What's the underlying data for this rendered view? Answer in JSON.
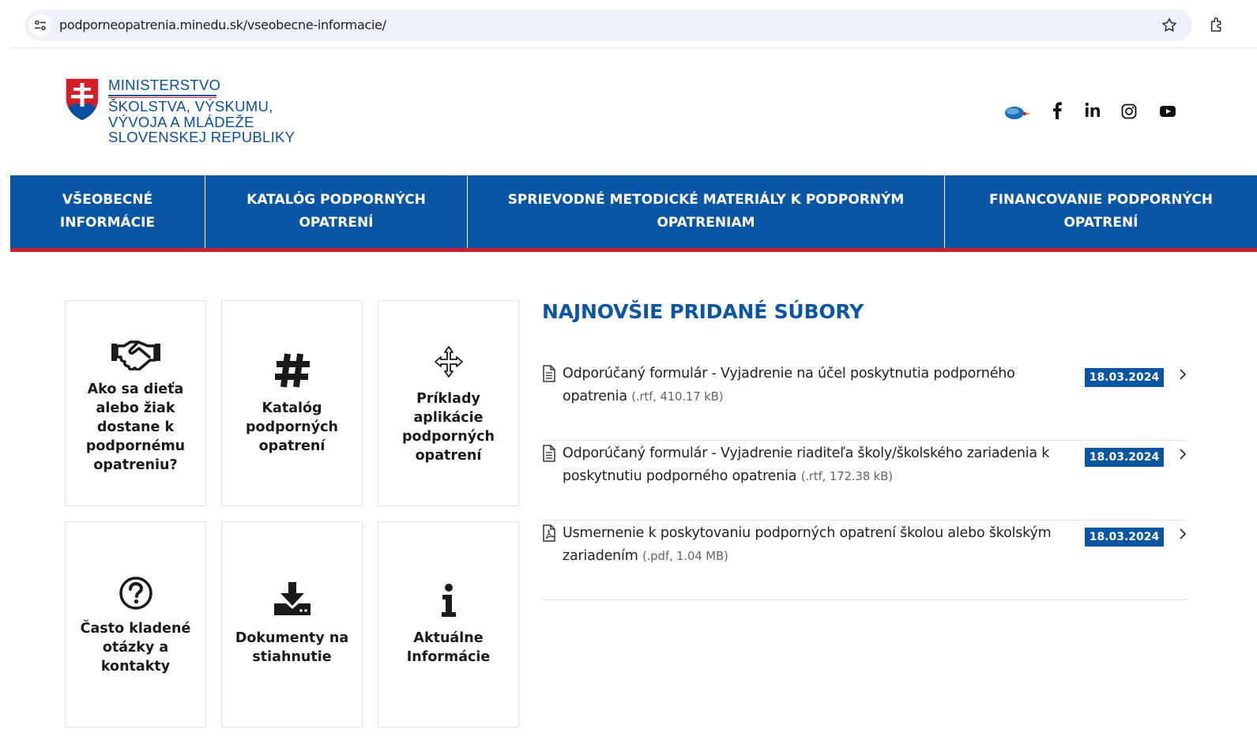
{
  "browser": {
    "url": "podporneopatrenia.minedu.sk/vseobecne-informacie/",
    "icons": [
      "site-info-icon",
      "star-icon",
      "extensions-icon"
    ]
  },
  "header": {
    "logo_line1": "MINISTERSTVO",
    "logo_line2": "ŠKOLSTVA, VÝSKUMU,",
    "logo_line3": "VÝVOJA A MLÁDEŽE",
    "logo_line4": "SLOVENSKEJ REPUBLIKY",
    "social": [
      "edu-tv-icon",
      "facebook-icon",
      "linkedin-icon",
      "instagram-icon",
      "youtube-icon"
    ]
  },
  "nav": {
    "items": [
      {
        "line1": "VŠEOBECNÉ",
        "line2": "INFORMÁCIE"
      },
      {
        "line1": "KATALÓG PODPORNÝCH",
        "line2": "OPATRENÍ"
      },
      {
        "line1": "SPRIEVODNÉ METODICKÉ MATERIÁLY K PODPORNÝM",
        "line2": "OPATRENIAM"
      },
      {
        "line1": "FINANCOVANIE PODPORNÝCH",
        "line2": "OPATRENÍ"
      }
    ]
  },
  "tiles": [
    {
      "label": "Ako sa dieťa alebo žiak dostane k podpornému opatreniu?",
      "icon": "handshake-icon"
    },
    {
      "label": "Katalóg podporných opatrení",
      "icon": "hashtag-icon"
    },
    {
      "label": "Príklady aplikácie podporných opatrení",
      "icon": "arrows-move-icon"
    },
    {
      "label": "Často kladené otázky a kontakty",
      "icon": "question-circle-icon"
    },
    {
      "label": "Dokumenty na stiahnutie",
      "icon": "download-icon"
    },
    {
      "label": "Aktuálne Informácie",
      "icon": "info-icon"
    }
  ],
  "files": {
    "title": "NAJNOVŠIE PRIDANÉ SÚBORY",
    "items": [
      {
        "text": "Odporúčaný formulár - Vyjadrenie na účel poskytnutia podporného opatrenia",
        "meta": "(.rtf, 410.17 kB)",
        "date": "18.03.2024",
        "icon": "document-icon"
      },
      {
        "text": "Odporúčaný formulár - Vyjadrenie riaditeľa školy/školského zariadenia k poskytnutiu podporného opatrenia",
        "meta": "(.rtf, 172.38 kB)",
        "date": "18.03.2024",
        "icon": "document-icon"
      },
      {
        "text": "Usmernenie k poskytovaniu podporných opatrení školou alebo školským zariadením",
        "meta": "(.pdf, 1.04 MB)",
        "date": "18.03.2024",
        "icon": "pdf-icon"
      }
    ]
  },
  "colors": {
    "primary": "#0b56a4",
    "accent_red": "#c8202e",
    "logo_blue": "#0b4fa3"
  }
}
